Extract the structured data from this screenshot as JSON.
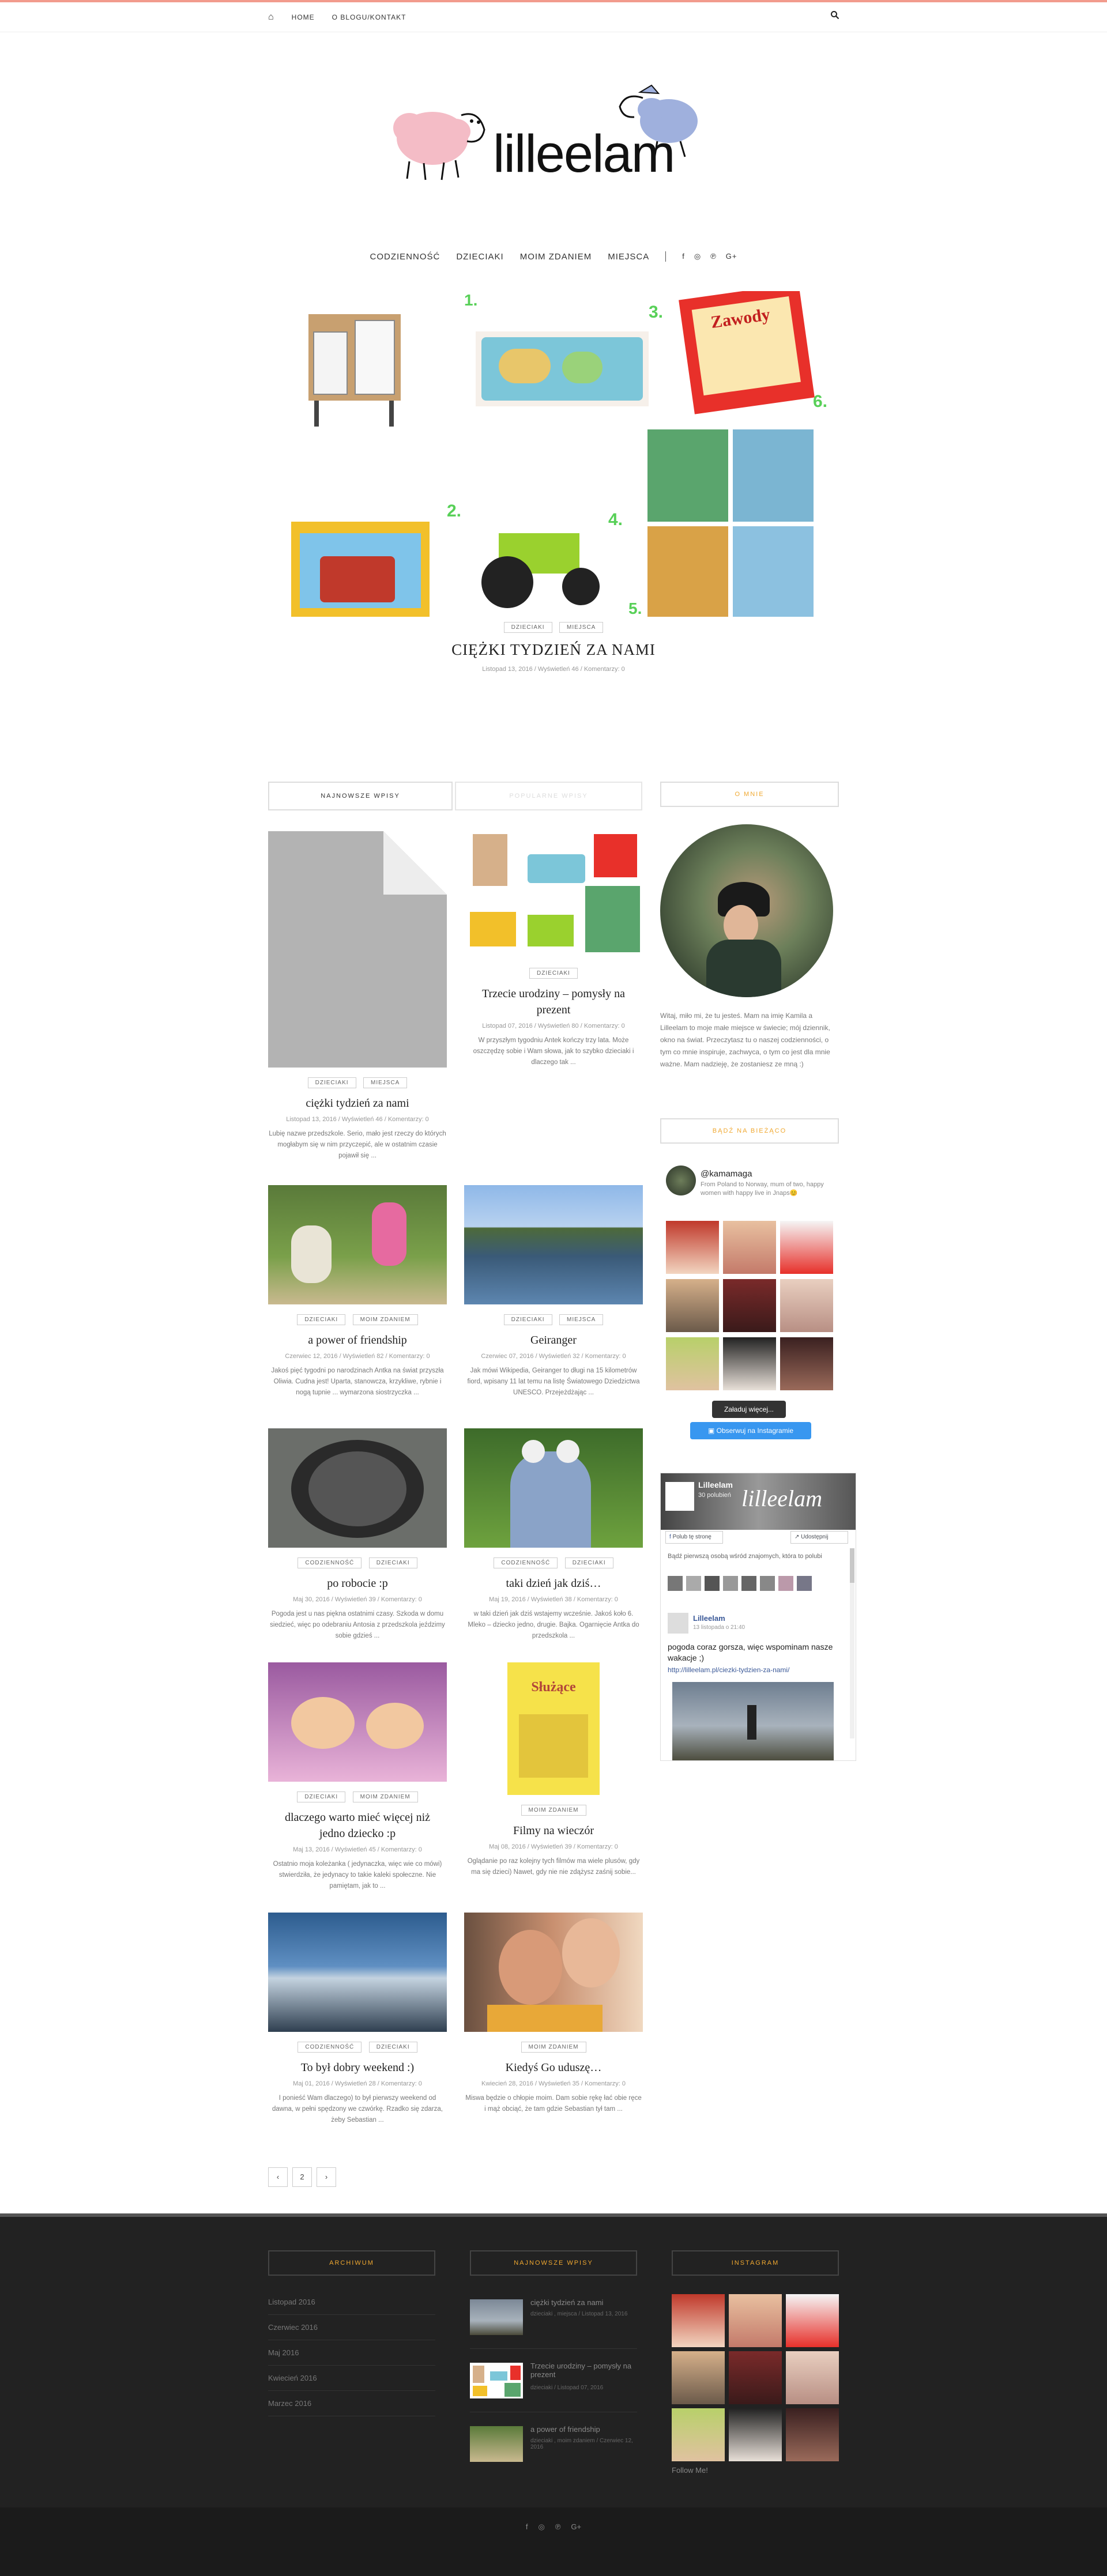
{
  "topnav": {
    "home": "HOME",
    "about": "O BLOGU/KONTAKT"
  },
  "logo": {
    "text": "lilleelam"
  },
  "mainnav": [
    "CODZIENNOŚĆ",
    "DZIECIAKI",
    "MOIM ZDANIEM",
    "MIEJSCA"
  ],
  "hero_numbers": [
    "1.",
    "3.",
    "6.",
    "2.",
    "4.",
    "5."
  ],
  "hero_card": "Zawody",
  "featured": {
    "tags": [
      "DZIECIAKI",
      "MIEJSCA"
    ],
    "title": "CIĘŻKI TYDZIEŃ ZA NAMI",
    "meta": "Listopad 13, 2016 / Wyświetleń 46 / Komentarzy: 0"
  },
  "tabs": {
    "newest": "NAJNOWSZE WPISY",
    "popular": "POPULARNE WPISY"
  },
  "posts": [
    {
      "tags": [
        "DZIECIAKI",
        "MIEJSCA"
      ],
      "title": "ciężki tydzień za nami",
      "meta": "Listopad 13, 2016 / Wyświetleń 46 / Komentarzy: 0",
      "excerpt": "Lubię nazwe przedszkole. Serio, mało jest rzeczy do których mogłabym się w nim przyczepić, ale w ostatnim czasie pojawił się ..."
    },
    {
      "tags": [
        "DZIECIAKI"
      ],
      "title": "Trzecie urodziny – pomysły na prezent",
      "meta": "Listopad 07, 2016 / Wyświetleń 80 / Komentarzy: 0",
      "excerpt": "W przyszłym tygodniu Antek kończy trzy lata. Może oszczędzę sobie i Wam słowa, jak to szybko dzieciaki i dlaczego tak ..."
    },
    {
      "tags": [
        "DZIECIAKI",
        "MOIM ZDANIEM"
      ],
      "title": "a power of friendship",
      "meta": "Czerwiec 12, 2016 / Wyświetleń 82 / Komentarzy: 0",
      "excerpt": "Jakoś pięć tygodni po narodzinach Antka na świat przyszła Oliwia. Cudna jest! Uparta, stanowcza, krzykliwe, rybnie i nogą tupnie ... wymarzona siostrzyczka ..."
    },
    {
      "tags": [
        "DZIECIAKI",
        "MIEJSCA"
      ],
      "title": "Geiranger",
      "meta": "Czerwiec 07, 2016 / Wyświetleń 32 / Komentarzy: 0",
      "excerpt": "Jak mówi Wikipedia, Geiranger to długi na 15 kilometrów fiord, wpisany 11 lat temu na listę Światowego Dziedzictwa UNESCO. Przejeżdżając ..."
    },
    {
      "tags": [
        "CODZIENNOŚĆ",
        "DZIECIAKI"
      ],
      "title": "po robocie :p",
      "meta": "Maj 30, 2016 / Wyświetleń 39 / Komentarzy: 0",
      "excerpt": "Pogoda jest u nas piękna ostatnimi czasy. Szkoda w domu siedzieć, więc po odebraniu Antosia z przedszkola jeździmy sobie gdzieś ..."
    },
    {
      "tags": [
        "CODZIENNOŚĆ",
        "DZIECIAKI"
      ],
      "title": "taki dzień jak dziś…",
      "meta": "Maj 19, 2016 / Wyświetleń 38 / Komentarzy: 0",
      "excerpt": "w taki dzień jak dziś wstajemy wcześnie. Jakoś koło 6. Mleko – dziecko jedno, drugie. Bajka. Ogarnięcie Antka do przedszkola ..."
    },
    {
      "tags": [
        "DZIECIAKI",
        "MOIM ZDANIEM"
      ],
      "title": "dlaczego warto mieć więcej niż jedno dziecko :p",
      "meta": "Maj 13, 2016 / Wyświetleń 45 / Komentarzy: 0",
      "excerpt": "Ostatnio moja koleżanka ( jedynaczka, więc wie co mówi) stwierdziła, że jedynacy to takie kaleki społeczne. Nie pamiętam, jak to ..."
    },
    {
      "tags": [
        "MOIM ZDANIEM"
      ],
      "title": "Filmy na wieczór",
      "meta": "Maj 08, 2016 / Wyświetleń 39 / Komentarzy: 0",
      "excerpt": "Oglądanie po raz kolejny tych filmów ma wiele plusów, gdy ma się dzieci) Nawet, gdy nie nie zdążysz zaśnij sobie..."
    },
    {
      "tags": [
        "CODZIENNOŚĆ",
        "DZIECIAKI"
      ],
      "title": "To był dobry weekend :)",
      "meta": "Maj 01, 2016 / Wyświetleń 28 / Komentarzy: 0",
      "excerpt": "I ponieść Wam dlaczego) to był pierwszy weekend od dawna, w pełni spędzony we czwórkę. Rzadko się zdarza, żeby Sebastian ..."
    },
    {
      "tags": [
        "MOIM ZDANIEM"
      ],
      "title": "Kiedyś Go uduszę…",
      "meta": "Kwiecień 28, 2016 / Wyświetleń 35 / Komentarzy: 0",
      "excerpt": "Miswa będzie o chłopie moim. Dam sobie rękę łać obie ręce i mąż obciąć, że tam gdzie Sebastian tył tam ..."
    }
  ],
  "movie_title": "Służące",
  "pagination": [
    "‹",
    "2",
    "›"
  ],
  "sidebar": {
    "about_head": "O MNIE",
    "about_text": "Witaj, miło mi, że tu jesteś. Mam na imię Kamila a Lilleelam to moje małe miejsce w świecie; mój dziennik, okno na świat. Przeczytasz tu o naszej codzienności, o tym co mnie inspiruje, zachwyca, o tym co jest dla mnie ważne. Mam nadzieję, że zostaniesz ze mną :)",
    "insta_head": "BĄDŹ NA BIEŻĄCO",
    "insta_user": "@kamamaga",
    "insta_bio": "From Poland to Norway, mum of two, happy women with happy live in Jnaps😊",
    "insta_more": "Załaduj więcej...",
    "insta_follow": "Obserwuj na Instagramie",
    "fb_name": "Lilleelam",
    "fb_likes": "30 polubień",
    "fb_like_btn": "Polub tę stronę",
    "fb_share_btn": "Udostępnij",
    "fb_friends": "Bądź pierwszą osobą wśród znajomych, która to polubi",
    "fb_post_name": "Lilleelam",
    "fb_post_time": "13 listopada o 21:40",
    "fb_post_text": "pogoda coraz gorsza, więc wspominam nasze wakacje ;)",
    "fb_post_link": "http://lilleelam.pl/ciezki-tydzien-za-nami/"
  },
  "footer": {
    "archive_head": "ARCHIWUM",
    "archive": [
      "Listopad 2016",
      "Czerwiec 2016",
      "Maj 2016",
      "Kwiecień 2016",
      "Marzec 2016"
    ],
    "recent_head": "NAJNOWSZE WPISY",
    "recent": [
      {
        "title": "ciężki tydzień za nami",
        "meta": "dzieciaki , miejsca / Listopad 13, 2016"
      },
      {
        "title": "Trzecie urodziny – pomysły na prezent",
        "meta": "dzieciaki / Listopad 07, 2016"
      },
      {
        "title": "a power of friendship",
        "meta": "dzieciaki , moim zdaniem / Czerwiec 12, 2016"
      }
    ],
    "insta_head": "INSTAGRAM",
    "follow": "Follow Me!"
  },
  "colors": {
    "accent": "#f0a830",
    "topline": "#f29b8d",
    "footer_bg": "#222222",
    "instagram_btn": "#3897f0",
    "fb_blue": "#3b5998"
  }
}
